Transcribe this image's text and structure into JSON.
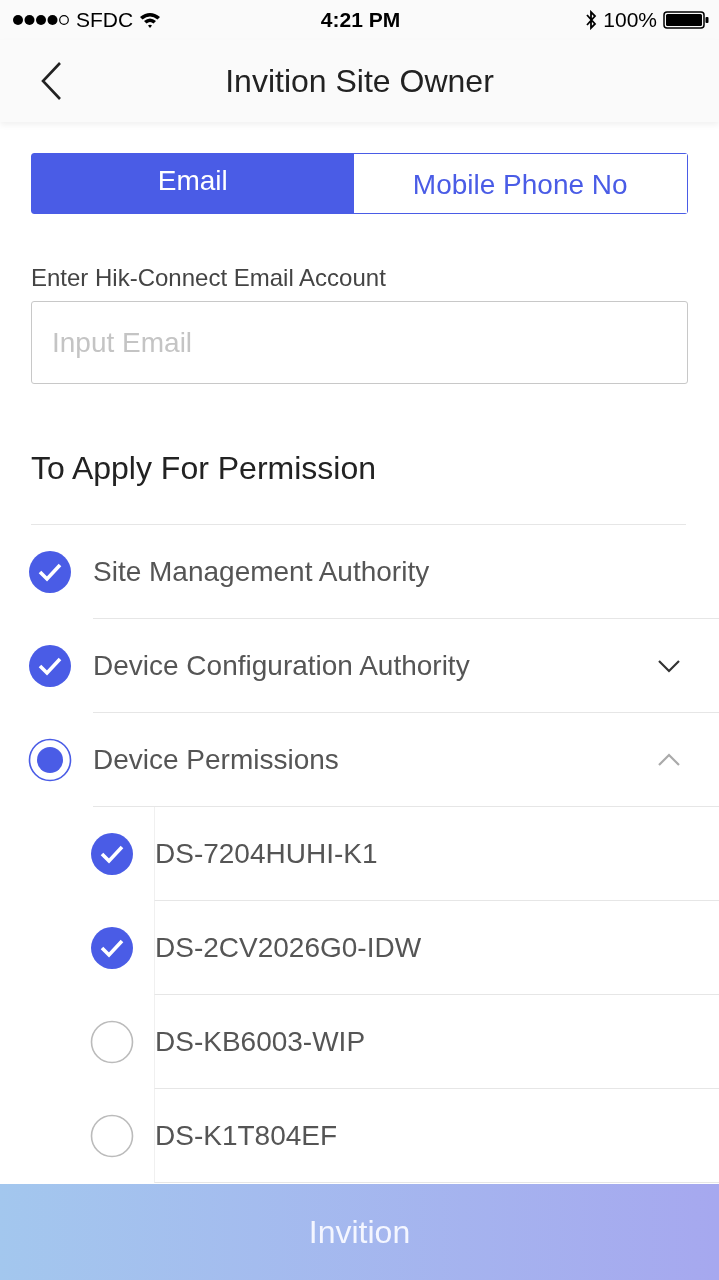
{
  "status_bar": {
    "carrier": "SFDC",
    "time": "4:21 PM",
    "battery": "100%"
  },
  "nav": {
    "title": "Invition Site Owner"
  },
  "tabs": [
    {
      "label": "Email",
      "selected": true
    },
    {
      "label": "Mobile Phone No",
      "selected": false
    }
  ],
  "account": {
    "label": "Enter Hik-Connect Email Account",
    "placeholder": "Input Email"
  },
  "permissions": {
    "title": "To Apply For Permission",
    "items": [
      {
        "label": "Site Management Authority",
        "checked": true
      },
      {
        "label": "Device Configuration Authority",
        "checked": true,
        "expanded": false
      },
      {
        "label": "Device Permissions",
        "checked": false,
        "partial": true,
        "expanded": true,
        "children": [
          {
            "label": "DS-7204HUHI-K1",
            "checked": true
          },
          {
            "label": "DS-2CV2026G0-IDW",
            "checked": true
          },
          {
            "label": "DS-KB6003-WIP",
            "checked": false
          },
          {
            "label": "DS-K1T804EF",
            "checked": false
          }
        ]
      }
    ]
  },
  "submit": {
    "label": "Invition"
  }
}
